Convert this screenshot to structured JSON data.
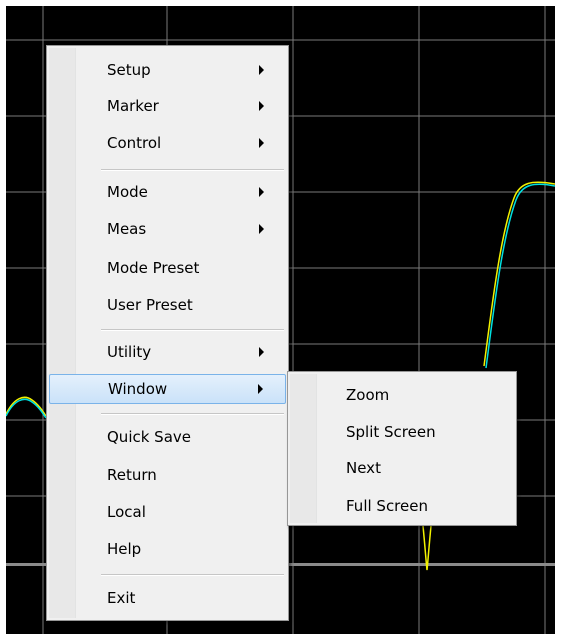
{
  "main_menu": {
    "items": [
      {
        "label": "Setup",
        "has_submenu": true
      },
      {
        "label": "Marker",
        "has_submenu": true
      },
      {
        "label": "Control",
        "has_submenu": true
      },
      {
        "label": "Mode",
        "has_submenu": true
      },
      {
        "label": "Meas",
        "has_submenu": true
      },
      {
        "label": "Mode Preset",
        "has_submenu": false
      },
      {
        "label": "User Preset",
        "has_submenu": false
      },
      {
        "label": "Utility",
        "has_submenu": true
      },
      {
        "label": "Window",
        "has_submenu": true,
        "highlighted": true
      },
      {
        "label": "Quick Save",
        "has_submenu": false
      },
      {
        "label": "Return",
        "has_submenu": false
      },
      {
        "label": "Local",
        "has_submenu": false
      },
      {
        "label": "Help",
        "has_submenu": false
      },
      {
        "label": "Exit",
        "has_submenu": false
      }
    ]
  },
  "window_submenu": {
    "items": [
      {
        "label": "Zoom"
      },
      {
        "label": "Split Screen"
      },
      {
        "label": "Next"
      },
      {
        "label": "Full Screen"
      }
    ]
  },
  "colors": {
    "plot_background": "#000000",
    "grid": "#7a7a7a",
    "trace_yellow": "#f2f200",
    "trace_cyan": "#00e0e0",
    "menu_background": "#f0f0f0",
    "highlight_border": "#7ab3e9"
  }
}
